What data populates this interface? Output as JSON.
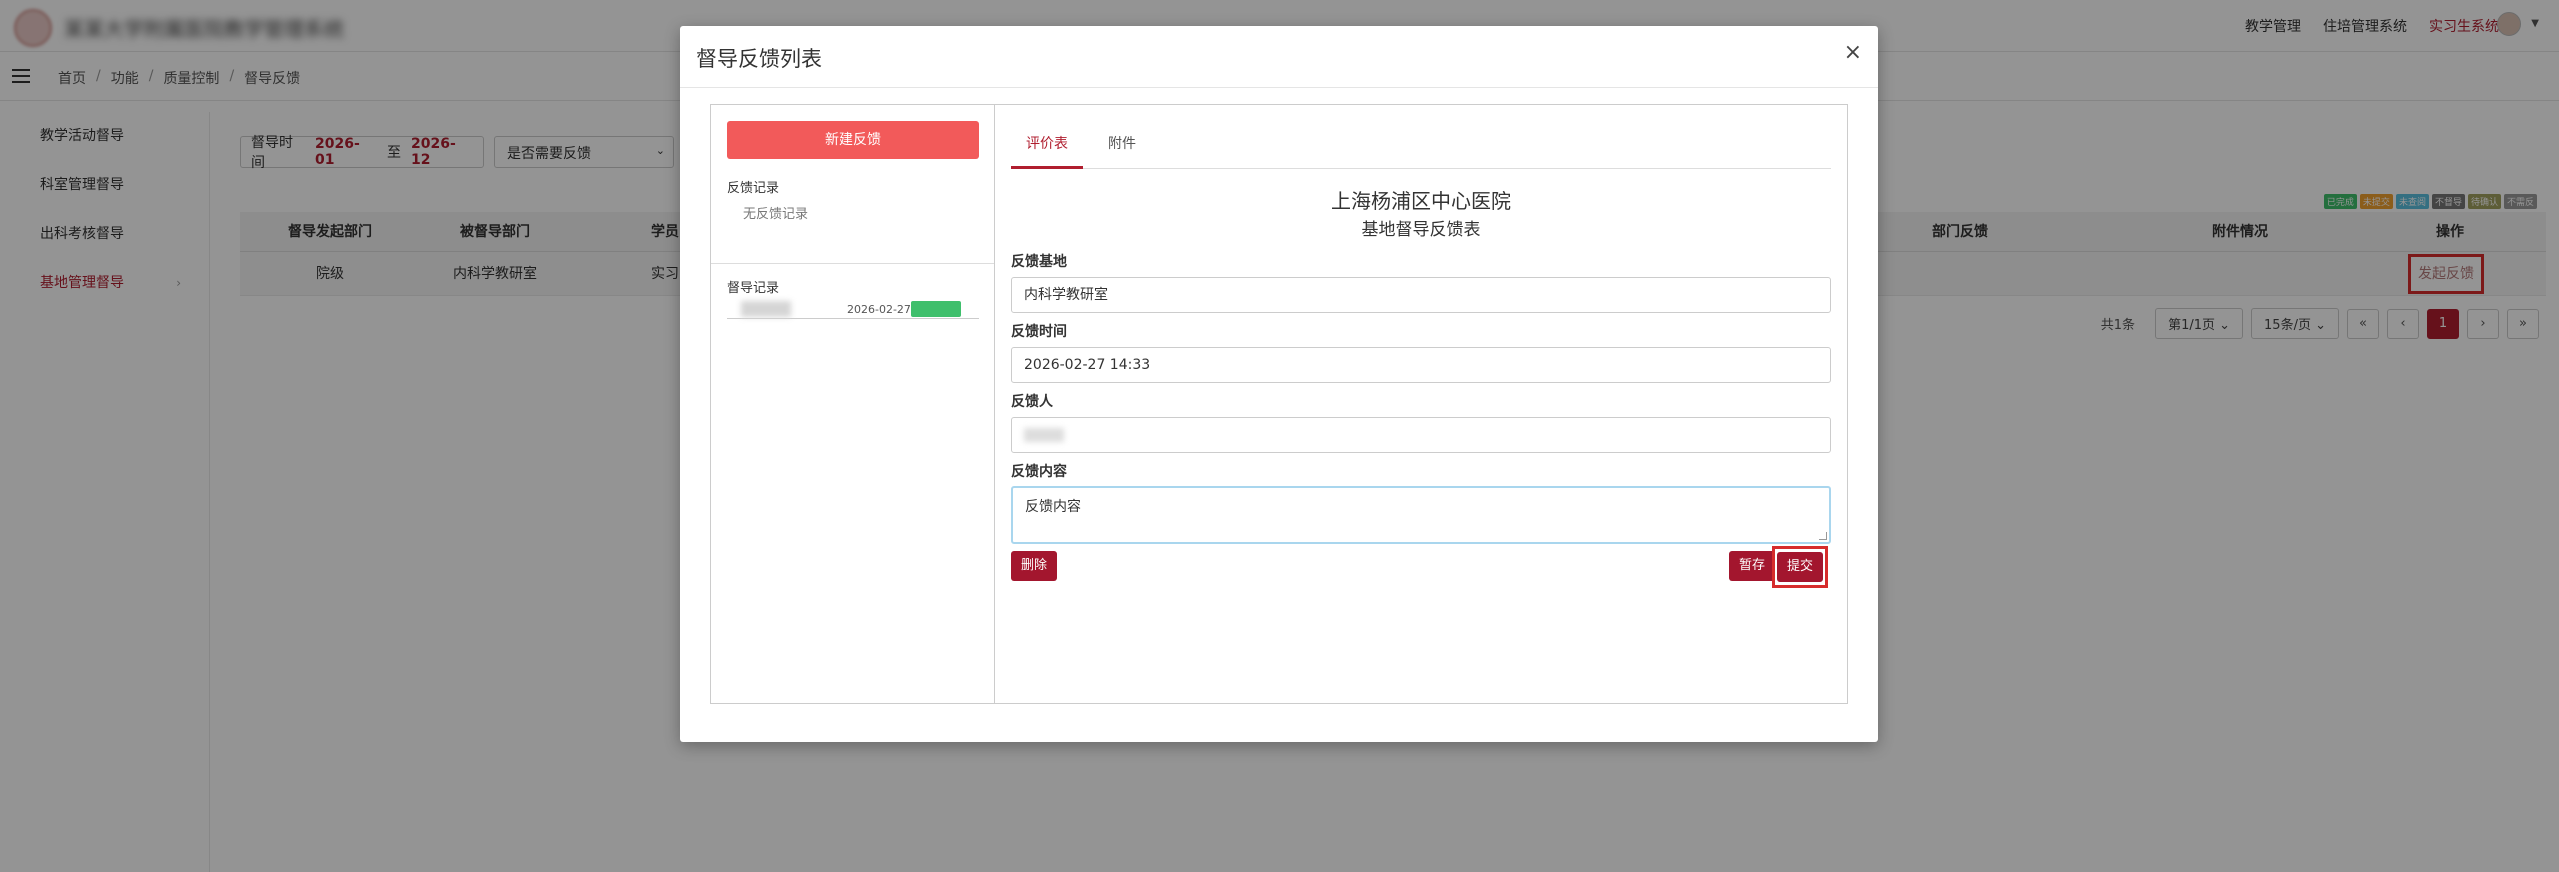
{
  "header": {
    "site_title": "某某大学附属医院教学管理系统",
    "nav": [
      {
        "label": "教学管理",
        "active": false
      },
      {
        "label": "住培管理系统",
        "active": false
      },
      {
        "label": "实习生系统",
        "active": true
      }
    ]
  },
  "breadcrumb": [
    "首页",
    "功能",
    "质量控制",
    "督导反馈"
  ],
  "sidebar": {
    "items": [
      {
        "label": "教学活动督导",
        "active": false
      },
      {
        "label": "科室管理督导",
        "active": false
      },
      {
        "label": "出科考核督导",
        "active": false
      },
      {
        "label": "基地管理督导",
        "active": true,
        "chevron": "›"
      }
    ]
  },
  "filters": {
    "time_label": "督导时间",
    "from": "2026-01",
    "to_word": "至",
    "to": "2026-12",
    "select_value": "是否需要反馈"
  },
  "legend": [
    {
      "label": "已完成",
      "color": "#3fbf6c"
    },
    {
      "label": "未提交",
      "color": "#f0a030"
    },
    {
      "label": "未查阅",
      "color": "#5bc0de"
    },
    {
      "label": "不督导",
      "color": "#777777"
    },
    {
      "label": "待确认",
      "color": "#a0a060"
    },
    {
      "label": "不需反",
      "color": "#999999"
    }
  ],
  "table": {
    "headers": [
      "督导发起部门",
      "被督导部门",
      "学员",
      "部门反馈",
      "附件情况",
      "操作"
    ],
    "rows": [
      {
        "dept_from": "院级",
        "dept_to": "内科学教研室",
        "student": "实习",
        "action": "发起反馈"
      }
    ]
  },
  "pager": {
    "total": "共1条",
    "page_select": "第1/1页",
    "size_select": "15条/页",
    "first": "«",
    "prev": "‹",
    "current": "1",
    "next": "›",
    "last": "»"
  },
  "modal": {
    "title": "督导反馈列表",
    "close": "×",
    "new_button": "新建反馈",
    "feedback_section": "反馈记录",
    "feedback_empty": "无反馈记录",
    "supervision_section": "督导记录",
    "record": {
      "date": "2026-02-27"
    },
    "tabs": [
      "评价表",
      "附件"
    ],
    "form": {
      "hospital": "上海杨浦区中心医院",
      "form_name": "基地督导反馈表",
      "base_label": "反馈基地",
      "base_value": "内科学教研室",
      "time_label": "反馈时间",
      "time_value": "2026-02-27 14:33",
      "person_label": "反馈人",
      "content_label": "反馈内容",
      "content_value": "反馈内容"
    },
    "buttons": {
      "delete": "删除",
      "save": "暂存",
      "submit": "提交"
    }
  },
  "colors": {
    "brand": "#b01e2f",
    "new_button": "#f25a5a",
    "highlight": "#d62c2c"
  }
}
